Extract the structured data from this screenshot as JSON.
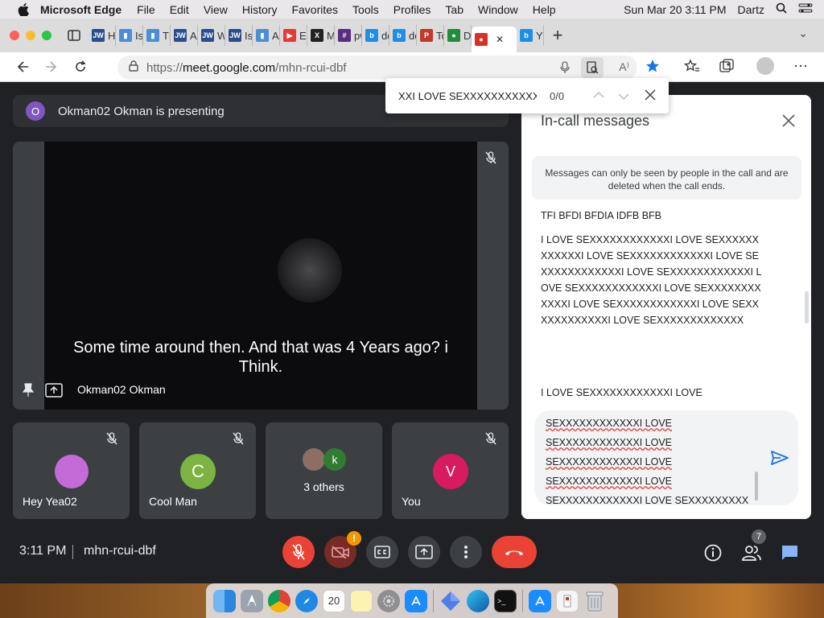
{
  "menubar": {
    "app_name": "Microsoft Edge",
    "items": [
      "File",
      "Edit",
      "View",
      "History",
      "Favorites",
      "Tools",
      "Profiles",
      "Tab",
      "Window",
      "Help"
    ],
    "datetime": "Sun Mar 20  3:11 PM",
    "user": "Dartz"
  },
  "tabs": [
    {
      "label": "Ho",
      "icon": "jw-icon",
      "color": "#2b4d8c"
    },
    {
      "label": "Is",
      "icon": "bookmark-icon",
      "color": "#4a8fd6"
    },
    {
      "label": "Th",
      "icon": "bookmark-icon",
      "color": "#4a8fd6"
    },
    {
      "label": "An",
      "icon": "jw-icon",
      "color": "#2b4d8c"
    },
    {
      "label": "Wh",
      "icon": "jw-icon",
      "color": "#2b4d8c"
    },
    {
      "label": "Is",
      "icon": "jw-icon",
      "color": "#2b4d8c"
    },
    {
      "label": "An",
      "icon": "bookmark-icon",
      "color": "#4a8fd6"
    },
    {
      "label": "Ed",
      "icon": "youtube-icon",
      "color": "#e53935"
    },
    {
      "label": "Ma",
      "icon": "x-icon",
      "color": "#222222"
    },
    {
      "label": "pw",
      "icon": "hash-icon",
      "color": "#5a2d82"
    },
    {
      "label": "do",
      "icon": "bing-icon",
      "color": "#1f8fe5"
    },
    {
      "label": "do",
      "icon": "bing-icon",
      "color": "#1f8fe5"
    },
    {
      "label": "To",
      "icon": "doc-icon",
      "color": "#c0392b"
    },
    {
      "label": "Do",
      "icon": "meet-icon",
      "color": "#1e8e3e"
    },
    {
      "label": "",
      "icon": "record-icon",
      "color": "#d93025",
      "active": true
    },
    {
      "label": "YO",
      "icon": "bing-icon",
      "color": "#1f8fe5"
    }
  ],
  "address": {
    "scheme": "https://",
    "host": "meet.google.com",
    "path": "/mhn-rcui-dbf"
  },
  "find": {
    "query": "XXI LOVE SEXXXXXXXXXXXXX",
    "count": "0/0"
  },
  "meet": {
    "presenter_initial": "O",
    "presenter_banner": "Okman02 Okman is presenting",
    "caption": "Some time around then. And that was 4 Years ago? i Think.",
    "main_name": "Okman02 Okman",
    "tiles": [
      {
        "name": "Hey Yea02",
        "initial": "",
        "color": "#c56bd8"
      },
      {
        "name": "Cool Man",
        "initial": "C",
        "color": "#7cb342"
      },
      {
        "name": "3 others",
        "initial": "k",
        "color": "#2e7d32"
      },
      {
        "name": "You",
        "initial": "V",
        "color": "#d81b60"
      }
    ],
    "time": "3:11 PM",
    "code": "mhn-rcui-dbf",
    "people_count": "7",
    "camera_warning": "!"
  },
  "chat": {
    "title": "In-call messages",
    "notice": "Messages can only be seen by people in the call and are deleted when the call ends.",
    "messages": [
      "TFI BFDI BFDIA IDFB BFB",
      "I LOVE SEXXXXXXXXXXXXI LOVE SEXXXXXXXXXXXXI LOVE SEXXXXXXXXXXXXI LOVE SEXXXXXXXXXXXXI LOVE SEXXXXXXXXXXXXI LOVE SEXXXXXXXXXXXXI LOVE SEXXXXXXXXXXXXI LOVE SEXXXXXXXXXXXXI LOVE SEXXXXXXXXXXXXI LOVE SEXXXXXXXXXXXXX",
      "I LOVE SEXXXXXXXXXXXXI LOVE"
    ],
    "draft_lines": [
      "SEXXXXXXXXXXXXI LOVE",
      "SEXXXXXXXXXXXXI LOVE",
      "SEXXXXXXXXXXXXI LOVE",
      "SEXXXXXXXXXXXXI LOVE",
      "SEXXXXXXXXXXXXI LOVE SEXXXXXXXXX"
    ]
  },
  "dock": [
    "finder",
    "launchpad",
    "chrome",
    "safari",
    "calendar",
    "notes",
    "settings",
    "app-store",
    "sketch",
    "edge",
    "terminal",
    "app-store-2",
    "preview",
    "trash"
  ]
}
